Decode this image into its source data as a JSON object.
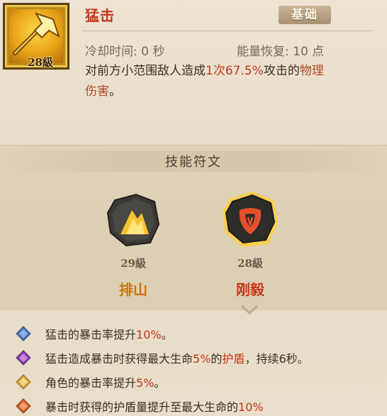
{
  "skill": {
    "level_label": "28級",
    "name": "猛击",
    "badge": "基础",
    "cooldown": "冷却时间: 0 秒",
    "energy": "能量恢复: 10 点",
    "description": {
      "p1": "对前方小范围敌人造成",
      "hits": "1次",
      "percent": "67.5%",
      "p2": "攻击的",
      "dmg_a": "物理",
      "dmg_b": "伤害",
      "end": "。"
    }
  },
  "runes": {
    "title": "技能符文",
    "items": [
      {
        "level": "29級",
        "name": "排山",
        "name_color": "#c9760a",
        "state": "unselected"
      },
      {
        "level": "28級",
        "name": "刚毅",
        "name_color": "#c8371a",
        "state": "selected"
      }
    ]
  },
  "effects": [
    {
      "diamond_color": "#4a79b8",
      "parts": [
        "猛击的暴击率提升",
        "10%",
        "。"
      ]
    },
    {
      "diamond_color": "#8a3fae",
      "parts": [
        "猛击造成暴击时获得最大生命",
        "5%",
        "的",
        "护盾",
        "，持续6秒。"
      ]
    },
    {
      "diamond_color": "#d2a63a",
      "parts": [
        "角色的暴击率提升",
        "5%",
        "。"
      ]
    },
    {
      "diamond_color": "#d2622a",
      "parts": [
        "暴击时获得的护盾量提升至最大生命的",
        "10%"
      ]
    }
  ],
  "colors": {
    "highlight_red": "#c8371a",
    "text_dark": "#3d2f1f",
    "text_muted": "#7a6a55"
  }
}
